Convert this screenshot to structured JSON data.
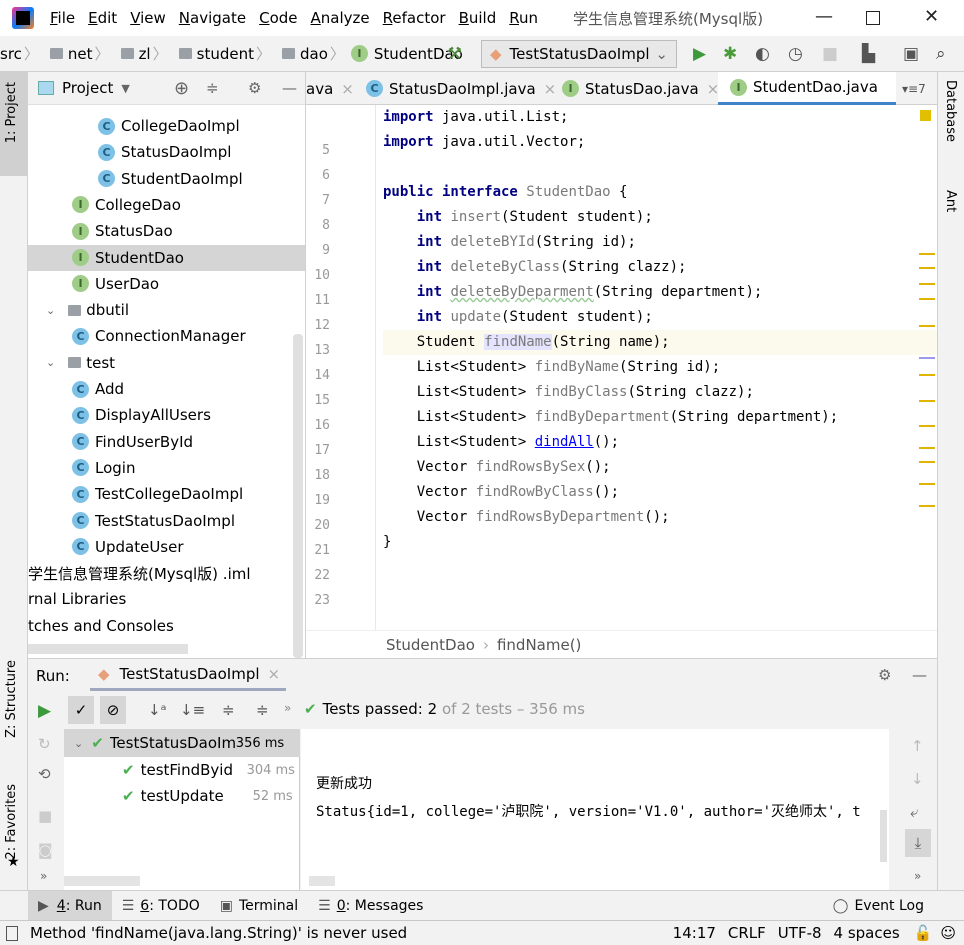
{
  "menubar": {
    "items": [
      "File",
      "Edit",
      "View",
      "Navigate",
      "Code",
      "Analyze",
      "Refactor",
      "Build",
      "Run"
    ],
    "title": "学生信息管理系统(Mysql版)"
  },
  "navbar": {
    "crumbs": [
      "src",
      "net",
      "zl",
      "student",
      "dao"
    ],
    "file": "StudentDao",
    "run_config": "TestStatusDaoImpl"
  },
  "left_strip": {
    "project": "1: Project",
    "structure": "Z: Structure",
    "favorites": "2: Favorites"
  },
  "right_strip": {
    "database": "Database",
    "ant": "Ant"
  },
  "project": {
    "title": "Project",
    "rows": [
      {
        "label": "CollegeDaoImpl",
        "type": "class",
        "indent": 3
      },
      {
        "label": "StatusDaoImpl",
        "type": "class",
        "indent": 3
      },
      {
        "label": "StudentDaoImpl",
        "type": "class",
        "indent": 3
      },
      {
        "label": "CollegeDao",
        "type": "interface",
        "indent": 2
      },
      {
        "label": "StatusDao",
        "type": "interface",
        "indent": 2
      },
      {
        "label": "StudentDao",
        "type": "interface",
        "indent": 2,
        "selected": true
      },
      {
        "label": "UserDao",
        "type": "interface",
        "indent": 2
      },
      {
        "label": "dbutil",
        "type": "folder",
        "indent": 1
      },
      {
        "label": "ConnectionManager",
        "type": "class",
        "indent": 2
      },
      {
        "label": "test",
        "type": "folder",
        "indent": 1
      },
      {
        "label": "Add",
        "type": "test",
        "indent": 2
      },
      {
        "label": "DisplayAllUsers",
        "type": "test",
        "indent": 2
      },
      {
        "label": "FindUserById",
        "type": "test",
        "indent": 2
      },
      {
        "label": "Login",
        "type": "test",
        "indent": 2
      },
      {
        "label": "TestCollegeDaoImpl",
        "type": "test",
        "indent": 2
      },
      {
        "label": "TestStatusDaoImpl",
        "type": "test",
        "indent": 2
      },
      {
        "label": "UpdateUser",
        "type": "test",
        "indent": 2
      },
      {
        "label": "学生信息管理系统(Mysql版)  .iml",
        "type": "plain",
        "indent": 0
      },
      {
        "label": "rnal Libraries",
        "type": "plain",
        "indent": 0
      },
      {
        "label": "tches and Consoles",
        "type": "plain",
        "indent": 0
      }
    ]
  },
  "editor": {
    "tabs": [
      {
        "label": "ava",
        "type": "none"
      },
      {
        "label": "StatusDaoImpl.java",
        "type": "class"
      },
      {
        "label": "StatusDao.java",
        "type": "interface"
      },
      {
        "label": "StudentDao.java",
        "type": "interface",
        "active": true
      }
    ],
    "tab_overflow": "7",
    "lines": [
      {
        "n": "5",
        "t": [
          [
            "import",
            "kw"
          ],
          [
            " java.util.List;",
            ""
          ]
        ]
      },
      {
        "n": "6",
        "t": [
          [
            "import",
            "kw"
          ],
          [
            " java.util.Vector;",
            ""
          ]
        ]
      },
      {
        "n": "7",
        "t": []
      },
      {
        "n": "8",
        "t": [
          [
            "public interface",
            "kw"
          ],
          [
            " ",
            ""
          ],
          [
            "StudentDao",
            "dim"
          ],
          [
            " {",
            ""
          ]
        ]
      },
      {
        "n": "9",
        "t": [
          [
            "    ",
            ""
          ],
          [
            "int",
            "kw"
          ],
          [
            " ",
            ""
          ],
          [
            "insert",
            "dim"
          ],
          [
            "(Student student);",
            ""
          ]
        ]
      },
      {
        "n": "10",
        "t": [
          [
            "    ",
            ""
          ],
          [
            "int",
            "kw"
          ],
          [
            " ",
            ""
          ],
          [
            "deleteBYId",
            "dim"
          ],
          [
            "(String id);",
            ""
          ]
        ]
      },
      {
        "n": "11",
        "t": [
          [
            "    ",
            ""
          ],
          [
            "int",
            "kw"
          ],
          [
            " ",
            ""
          ],
          [
            "deleteByClass",
            "dim"
          ],
          [
            "(String clazz);",
            ""
          ]
        ]
      },
      {
        "n": "12",
        "t": [
          [
            "    ",
            ""
          ],
          [
            "int",
            "kw"
          ],
          [
            " ",
            ""
          ],
          [
            "deleteByDeparment",
            "wavy"
          ],
          [
            "(String department);",
            ""
          ]
        ]
      },
      {
        "n": "13",
        "t": [
          [
            "    ",
            ""
          ],
          [
            "int",
            "kw"
          ],
          [
            " ",
            ""
          ],
          [
            "update",
            "dim"
          ],
          [
            "(Student student);",
            ""
          ]
        ]
      },
      {
        "n": "14",
        "t": [
          [
            "    Student ",
            ""
          ],
          [
            "findName",
            "dimu"
          ],
          [
            "(String name);",
            ""
          ]
        ],
        "current": true
      },
      {
        "n": "15",
        "t": [
          [
            "    List<Student> ",
            ""
          ],
          [
            "findByName",
            "dim"
          ],
          [
            "(String id);",
            ""
          ]
        ]
      },
      {
        "n": "16",
        "t": [
          [
            "    List<Student> ",
            ""
          ],
          [
            "findByClass",
            "dim"
          ],
          [
            "(String clazz);",
            ""
          ]
        ]
      },
      {
        "n": "17",
        "t": [
          [
            "    List<Student> ",
            ""
          ],
          [
            "findByDepartment",
            "dim"
          ],
          [
            "(String department);",
            ""
          ]
        ]
      },
      {
        "n": "18",
        "t": [
          [
            "    List<Student> ",
            ""
          ],
          [
            "dindAll",
            "link"
          ],
          [
            "();",
            ""
          ]
        ]
      },
      {
        "n": "19",
        "t": [
          [
            "    Vector ",
            ""
          ],
          [
            "findRowsBySex",
            "dim"
          ],
          [
            "();",
            ""
          ]
        ]
      },
      {
        "n": "20",
        "t": [
          [
            "    Vector ",
            ""
          ],
          [
            "findRowByClass",
            "dim"
          ],
          [
            "();",
            ""
          ]
        ]
      },
      {
        "n": "21",
        "t": [
          [
            "    Vector ",
            ""
          ],
          [
            "findRowsByDepartment",
            "dim"
          ],
          [
            "();",
            ""
          ]
        ]
      },
      {
        "n": "22",
        "t": [
          [
            "}",
            ""
          ]
        ]
      },
      {
        "n": "23",
        "t": []
      }
    ],
    "breadcrumb": [
      "StudentDao",
      "findName()"
    ]
  },
  "run": {
    "label": "Run:",
    "tab": "TestStatusDaoImpl",
    "status_prefix": "Tests passed:",
    "status_count": "2",
    "status_rest": "of 2 tests – 356 ms",
    "tree": [
      {
        "name": "TestStatusDaoImpl",
        "time": "356 ms"
      },
      {
        "name": "testFindByid",
        "time": "304 ms"
      },
      {
        "name": "testUpdate",
        "time": "52 ms"
      }
    ],
    "console": [
      "更新成功",
      "Status{id=1, college='泸职院', version='V1.0', author='灭绝师太', t"
    ]
  },
  "bottom_tabs": [
    {
      "key": "4",
      "label": ": Run"
    },
    {
      "key": "6",
      "label": ": TODO"
    },
    {
      "key": "",
      "label": "Terminal"
    },
    {
      "key": "0",
      "label": ": Messages"
    }
  ],
  "event_log": "Event Log",
  "status": {
    "message": "Method 'findName(java.lang.String)' is never used",
    "position": "14:17",
    "line_sep": "CRLF",
    "encoding": "UTF-8",
    "indent": "4 spaces"
  },
  "colors": {
    "accent": "#4083c9",
    "pass": "#4caf50",
    "keyword": "#000080",
    "warning_mark": "#e0b400"
  }
}
